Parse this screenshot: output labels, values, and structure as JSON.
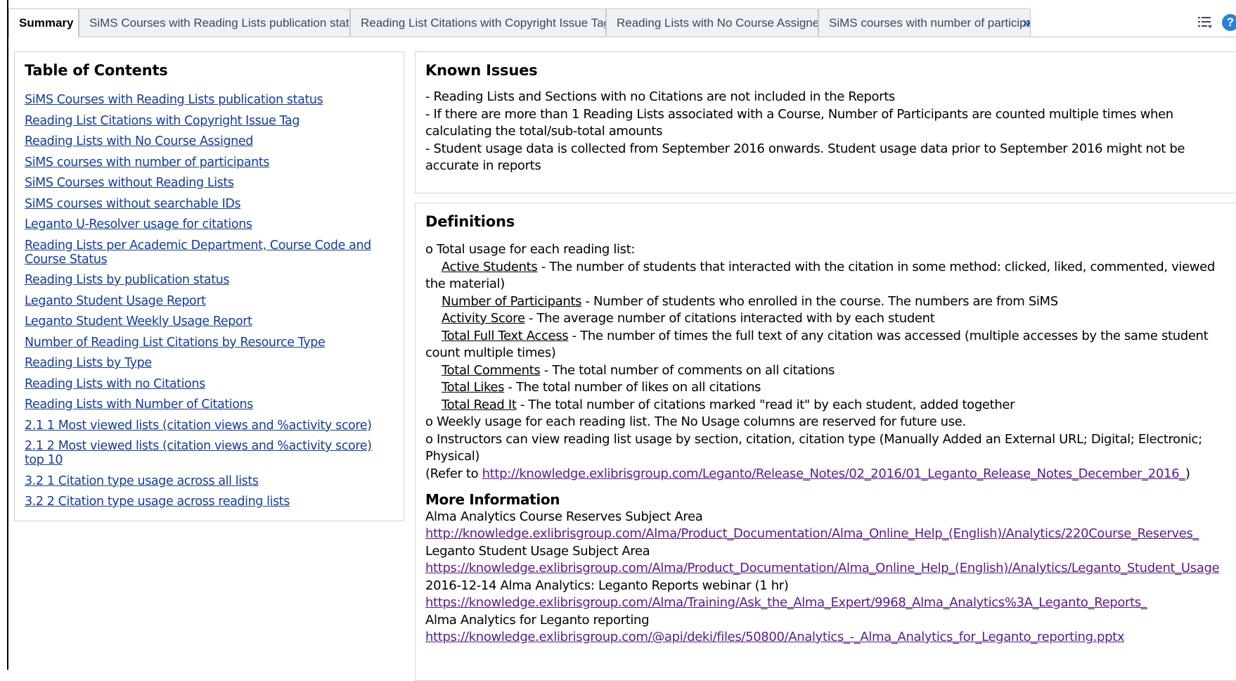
{
  "tabs": [
    {
      "label": "Summary"
    },
    {
      "label": "SiMS Courses with Reading Lists publication status"
    },
    {
      "label": "Reading List Citations with Copyright Issue Tag"
    },
    {
      "label": "Reading Lists with No Course Assigned"
    },
    {
      "label": "SiMS courses with number of participants"
    }
  ],
  "tab_overflow": "»",
  "icons": {
    "list": "list-options-icon",
    "help": "help-icon"
  },
  "help_glyph": "?",
  "toc": {
    "title": "Table of Contents",
    "links": [
      "SiMS Courses with Reading Lists publication status",
      "Reading List Citations with Copyright Issue Tag",
      "Reading Lists with No Course Assigned",
      "SiMS courses with number of participants",
      "SiMS Courses without Reading Lists",
      "SiMS courses without searchable IDs",
      "Leganto U-Resolver usage for citations",
      "Reading Lists per Academic Department, Course Code and Course Status",
      "Reading Lists by publication status",
      "Leganto Student Usage Report",
      "Leganto Student Weekly Usage Report",
      "Number of Reading List Citations by Resource Type",
      "Reading Lists by Type",
      "Reading Lists with no Citations",
      "Reading Lists with Number of Citations",
      "2.1 1 Most viewed lists (citation views and %activity score)",
      "2.1 2 Most viewed lists (citation views and %activity score) top 10",
      "3.2 1 Citation type usage across all lists",
      "3.2 2 Citation type usage across reading lists"
    ]
  },
  "known_issues": {
    "title": "Known Issues",
    "lines": [
      "- Reading Lists and Sections with no Citations are not included in the Reports",
      "- If there are more than 1 Reading Lists associated with a Course, Number of Participants are counted multiple times when calculating the total/sub-total amounts",
      "- Student usage data is collected from September 2016 onwards. Student usage data prior to September 2016 might not be accurate in reports"
    ]
  },
  "definitions": {
    "title": "Definitions",
    "total_usage": "o Total usage for each reading list:",
    "terms": [
      {
        "term": "Active Students",
        "desc": " - The number of students that interacted with the citation in some method: clicked, liked, commented, viewed the material)"
      },
      {
        "term": "Number of Participants",
        "desc": " - Number of students who enrolled in the course. The numbers are from SiMS"
      },
      {
        "term": "Activity Score",
        "desc": " - The average number of citations interacted with by each student"
      },
      {
        "term": "Total Full Text Access",
        "desc": " - The number of times the full text of any citation was accessed (multiple accesses by the same student count multiple times)"
      },
      {
        "term": "Total Comments",
        "desc": " - The total number of comments on all citations"
      },
      {
        "term": "Total Likes",
        "desc": " - The total number of likes on all citations"
      },
      {
        "term": "Total Read It",
        "desc": " - The total number of citations marked \"read it\" by each student, added together"
      }
    ],
    "weekly": "o Weekly usage for each reading list. The No Usage columns are reserved for future use.",
    "instructors": "o Instructors can view reading list usage by section, citation, citation type (Manually Added an External URL; Digital; Electronic; Physical)",
    "refer_prefix": "(Refer to ",
    "refer_link": "http://knowledge.exlibrisgroup.com/Leganto/Release_Notes/02_2016/01_Leganto_Release_Notes_December_2016_",
    "refer_suffix": ")"
  },
  "more_info": {
    "title": "More Information",
    "items": [
      {
        "label": "Alma Analytics Course Reserves Subject Area",
        "url": "http://knowledge.exlibrisgroup.com/Alma/Product_Documentation/Alma_Online_Help_(English)/Analytics/220Course_Reserves_"
      },
      {
        "label": "Leganto Student Usage Subject Area",
        "url": "https://knowledge.exlibrisgroup.com/Alma/Product_Documentation/Alma_Online_Help_(English)/Analytics/Leganto_Student_Usage"
      },
      {
        "label": "2016-12-14 Alma Analytics: Leganto Reports webinar (1 hr)",
        "url": "https://knowledge.exlibrisgroup.com/Alma/Training/Ask_the_Alma_Expert/9968_Alma_Analytics%3A_Leganto_Reports_"
      },
      {
        "label": "Alma Analytics for Leganto reporting",
        "url": "https://knowledge.exlibrisgroup.com/@api/deki/files/50800/Analytics_-_Alma_Analytics_for_Leganto_reporting.pptx"
      }
    ]
  },
  "colors": {
    "link": "#153d99",
    "visited_link": "#5a1b8c",
    "panel_border": "#cfd6de",
    "tab_bg": "#eef1f5",
    "help_bg": "#2f7fd6"
  }
}
